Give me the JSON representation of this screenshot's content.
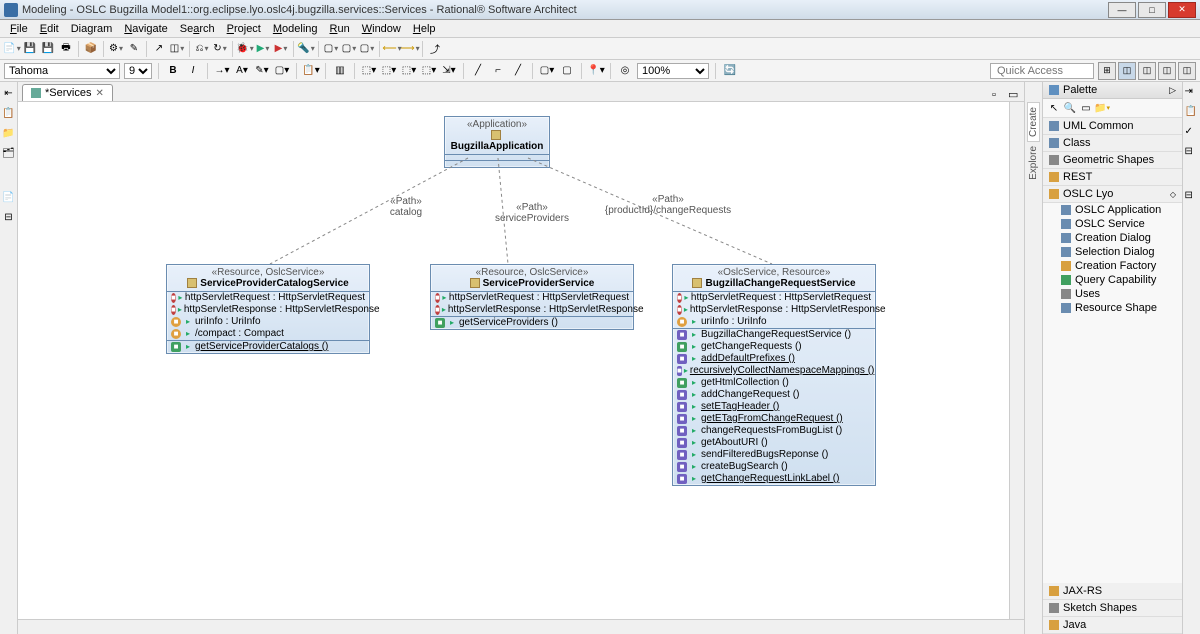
{
  "title": "Modeling - OSLC Bugzilla Model1::org.eclipse.lyo.oslc4j.bugzilla.services::Services - Rational® Software Architect",
  "menu": [
    "File",
    "Edit",
    "Diagram",
    "Navigate",
    "Search",
    "Project",
    "Modeling",
    "Run",
    "Window",
    "Help"
  ],
  "font": {
    "name": "Tahoma",
    "size": "9"
  },
  "zoom": "100%",
  "quickaccess_placeholder": "Quick Access",
  "tab": {
    "label": "*Services"
  },
  "diagram": {
    "app": {
      "stereo": "«Application»",
      "name": "BugzillaApplication"
    },
    "paths": [
      {
        "stereo": "«Path»",
        "label": "catalog"
      },
      {
        "stereo": "«Path»",
        "label": "serviceProviders"
      },
      {
        "stereo": "«Path»",
        "label": "{productId}/changeRequests"
      }
    ],
    "node1": {
      "stereo": "«Resource, OslcService»",
      "name": "ServiceProviderCatalogService",
      "attrs": [
        {
          "icon": "attr",
          "text": "httpServletRequest : HttpServletRequest"
        },
        {
          "icon": "attr",
          "text": "httpServletResponse : HttpServletResponse"
        },
        {
          "icon": "attr2",
          "text": "uriInfo : UriInfo"
        },
        {
          "icon": "attr2",
          "text": "/compact : Compact"
        }
      ],
      "ops": [
        {
          "icon": "op",
          "text": "getServiceProviderCatalogs ()",
          "under": true
        }
      ]
    },
    "node2": {
      "stereo": "«Resource, OslcService»",
      "name": "ServiceProviderService",
      "attrs": [
        {
          "icon": "attr",
          "text": "httpServletRequest : HttpServletRequest"
        },
        {
          "icon": "attr",
          "text": "httpServletResponse : HttpServletResponse"
        }
      ],
      "ops": [
        {
          "icon": "op",
          "text": "getServiceProviders ()"
        }
      ]
    },
    "node3": {
      "stereo": "«OslcService, Resource»",
      "name": "BugzillaChangeRequestService",
      "attrs": [
        {
          "icon": "attr",
          "text": "httpServletRequest : HttpServletRequest"
        },
        {
          "icon": "attr",
          "text": "httpServletResponse : HttpServletResponse"
        },
        {
          "icon": "attr2",
          "text": "uriInfo : UriInfo"
        }
      ],
      "ops": [
        {
          "icon": "op2",
          "text": "BugzillaChangeRequestService ()"
        },
        {
          "icon": "op",
          "text": "getChangeRequests ()"
        },
        {
          "icon": "op2",
          "text": "addDefaultPrefixes ()",
          "under": true
        },
        {
          "icon": "op2",
          "text": "recursivelyCollectNamespaceMappings ()",
          "under": true
        },
        {
          "icon": "op",
          "text": "getHtmlCollection ()"
        },
        {
          "icon": "op2",
          "text": "addChangeRequest ()"
        },
        {
          "icon": "op2",
          "text": "setETagHeader ()",
          "under": true
        },
        {
          "icon": "op2",
          "text": "getETagFromChangeRequest ()",
          "under": true
        },
        {
          "icon": "op2",
          "text": "changeRequestsFromBugList ()"
        },
        {
          "icon": "op2",
          "text": "getAboutURI ()"
        },
        {
          "icon": "op2",
          "text": "sendFilteredBugsReponse ()"
        },
        {
          "icon": "op2",
          "text": "createBugSearch ()"
        },
        {
          "icon": "op2",
          "text": "getChangeRequestLinkLabel ()",
          "under": true
        }
      ]
    }
  },
  "palette": {
    "title": "Palette",
    "explore": "Explore",
    "create": "Create",
    "groups": [
      {
        "label": "UML Common",
        "icon": "#6a8cb0"
      },
      {
        "label": "Class",
        "icon": "#6a8cb0"
      },
      {
        "label": "Geometric Shapes",
        "icon": "#888"
      },
      {
        "label": "REST",
        "icon": "#d8a040",
        "folder": true
      },
      {
        "label": "OSLC Lyo",
        "icon": "#d8a040",
        "folder": true,
        "open": true
      }
    ],
    "items": [
      {
        "label": "OSLC Application",
        "color": "#6a8cb0"
      },
      {
        "label": "OSLC Service",
        "color": "#6a8cb0"
      },
      {
        "label": "Creation Dialog",
        "color": "#6a8cb0"
      },
      {
        "label": "Selection Dialog",
        "color": "#6a8cb0"
      },
      {
        "label": "Creation Factory",
        "color": "#d8a040"
      },
      {
        "label": "Query Capability",
        "color": "#40a060"
      },
      {
        "label": "Uses",
        "color": "#888"
      },
      {
        "label": "Resource Shape",
        "color": "#6a8cb0"
      }
    ],
    "bottom": [
      {
        "label": "JAX-RS",
        "icon": "#d8a040"
      },
      {
        "label": "Sketch Shapes",
        "icon": "#888"
      },
      {
        "label": "Java",
        "icon": "#d8a040"
      }
    ]
  }
}
